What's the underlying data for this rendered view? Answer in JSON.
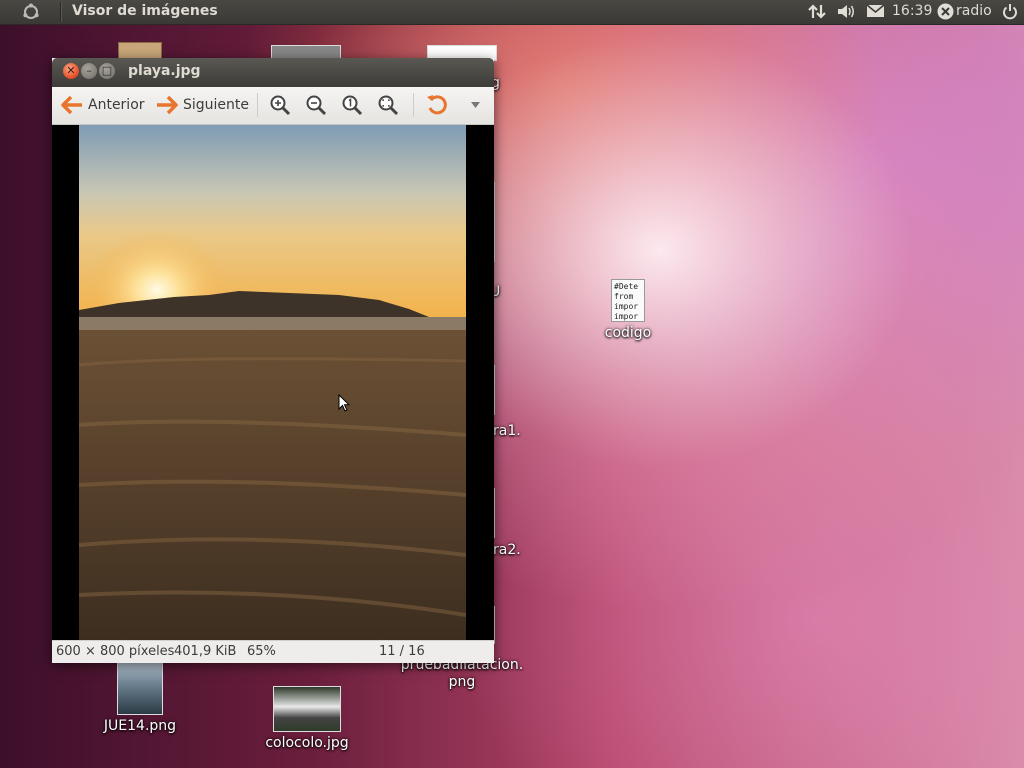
{
  "panel": {
    "app_title": "Visor de imágenes",
    "clock": "16:39",
    "user": "radio",
    "icons": [
      "ubuntu-logo-icon",
      "network-icon",
      "volume-icon",
      "mail-icon",
      "user-icon",
      "power-icon"
    ]
  },
  "desktop": {
    "icons": [
      {
        "label": "JUE14.png"
      },
      {
        "label": "colocolo.jpg"
      },
      {
        "label": "pruebadilatacion.\npng"
      },
      {
        "label": "codigo",
        "preview": "#Dete\nfrom\nimpor\nimpor"
      },
      {
        "label": "g"
      },
      {
        "label": "U"
      },
      {
        "label": "ra1."
      },
      {
        "label": "ra2."
      }
    ]
  },
  "window": {
    "title": "playa.jpg",
    "toolbar": {
      "prev_label": "Anterior",
      "next_label": "Siguiente"
    },
    "status": {
      "dimensions": "600 × 800 píxeles",
      "size": "401,9 KiB",
      "zoom": "65%",
      "counter": "11 / 16"
    }
  },
  "colors": {
    "panel_bg": "#3b3935",
    "close_button": "#e8552d",
    "arrow_orange": "#e8752d"
  }
}
